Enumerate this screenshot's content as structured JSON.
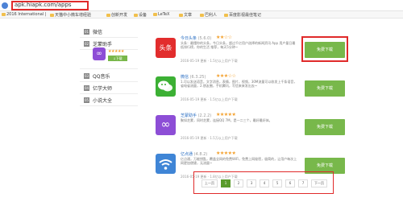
{
  "browser": {
    "url": "apk.hiapk.com/apps",
    "bookmarks": [
      "2016 International |",
      "天猫中小微车增经验",
      "创新开发",
      "设备",
      "LeTeX",
      "文章",
      "巴利人",
      "百度影视最佳笔记"
    ]
  },
  "sidebar": {
    "items": [
      {
        "num": "01",
        "label": "微信"
      },
      {
        "num": "02",
        "label": "芝蒙助手"
      },
      {
        "num": "03",
        "label": "QQ音乐"
      },
      {
        "num": "04",
        "label": "亿学大师"
      },
      {
        "num": "05",
        "label": "小说大全"
      }
    ],
    "expanded": {
      "stars": "★★★★★",
      "download": "↓下载"
    }
  },
  "apps": [
    {
      "name": "今日头条",
      "version": "(5.6.0)",
      "stars": "★★☆☆",
      "desc": "头条：最懂你的头条，今日头条，超过千亿用户选择的新闻资讯 App 用户量日最低排行榜，你的生活 推荐，每天5分钟~",
      "meta": "2016-05-19 更新  · 1.5亿以上用户下载",
      "button": "免费下载",
      "icon_text": "头条",
      "color": "#e22d2d"
    },
    {
      "name": "微信",
      "version": "(6.3.25)",
      "stars": "★★★☆☆",
      "desc": "1.可以发送语音，文字消息，表情，图片，视频，30M流量可以收发上千条语音，省电省流量，2.朋友圈，手机腾讯，写信来来发出去~",
      "meta": "2016-05-19 更新  · 1.5亿以上用户下载",
      "button": "免费下载",
      "icon_text": "",
      "color": "#3cb034"
    },
    {
      "name": "芝蒙助手",
      "version": "(2.2.2)",
      "stars": "★★★★★",
      "desc": "聚如芝蒙，同时芝蒙，连接QQ 7M，是一二三个，最好最好体。",
      "meta": "2016-05-19 更新  · 1.5万以上用户下载",
      "button": "免费下载",
      "icon_text": "",
      "color": "#8d4ed6"
    },
    {
      "name": "亿点通",
      "version": "(4.8.2)",
      "stars": "★★★★★",
      "desc": "亿点通，万能钥匙，覆盖全网的免费WiFi，免费上网秘密，极简的，让用户每次上网更加便捷，无流量~",
      "meta": "2016-05-19 更新  · 1.8亿以上用户下载",
      "button": "免费下载",
      "icon_text": "",
      "color": "#3f85d6"
    }
  ],
  "pager": {
    "prev": "上一页",
    "pages": [
      "1",
      "2",
      "3",
      "4",
      "5",
      "6",
      "7"
    ],
    "next": "下一页",
    "current": 1
  }
}
